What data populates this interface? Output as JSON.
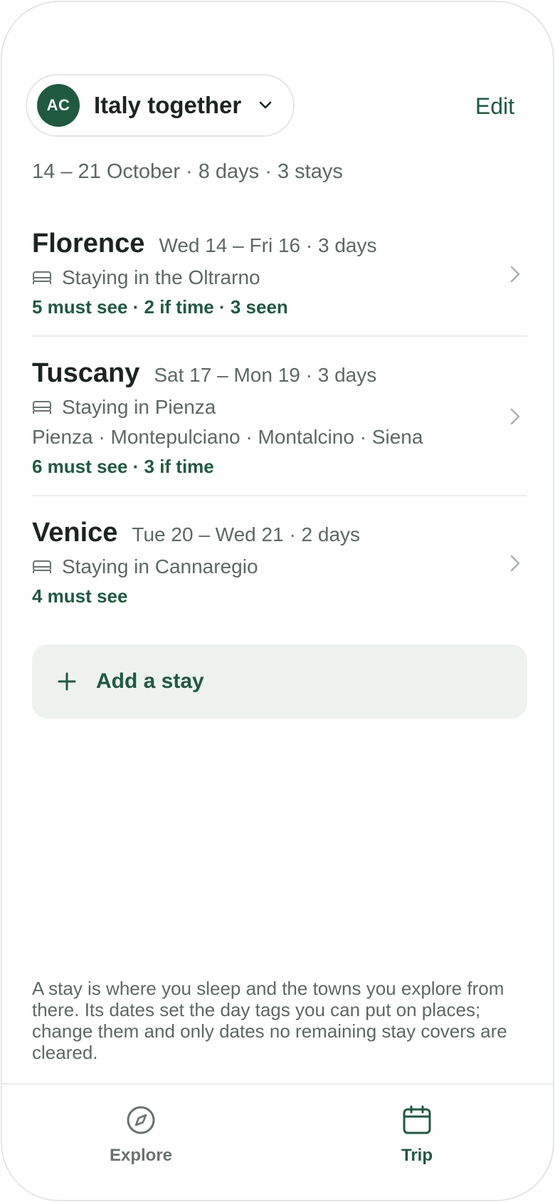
{
  "header": {
    "avatar_initials": "AC",
    "trip_name": "Italy together",
    "edit_label": "Edit",
    "summary": "14 – 21 October · 8 days · 3 stays"
  },
  "stays": [
    {
      "city": "Florence",
      "dates": "Wed 14 – Fri 16 · 3 days",
      "staying": "Staying in the Oltrarno",
      "stats": "5 must see · 2 if time · 3 seen"
    },
    {
      "city": "Tuscany",
      "dates": "Sat 17 – Mon 19 · 3 days",
      "staying": "Staying in Pienza",
      "towns": "Pienza · Montepulciano · Montalcino · Siena",
      "stats": "6 must see · 3 if time"
    },
    {
      "city": "Venice",
      "dates": "Tue 20 – Wed 21 · 2 days",
      "staying": "Staying in Cannaregio",
      "stats": "4 must see"
    }
  ],
  "add_stay_label": "Add a stay",
  "note": "A stay is where you sleep and the towns you explore from there. Its dates set the day tags you can put on places; change them and only dates no remaining stay covers are cleared.",
  "tabs": {
    "explore": {
      "label": "Explore",
      "icon": "compass-icon"
    },
    "trip": {
      "label": "Trip",
      "icon": "calendar-icon",
      "active": true
    }
  },
  "colors": {
    "accent": "#1e5a40",
    "muted_text": "#5e6764",
    "add_button_bg": "#eef2ef"
  }
}
